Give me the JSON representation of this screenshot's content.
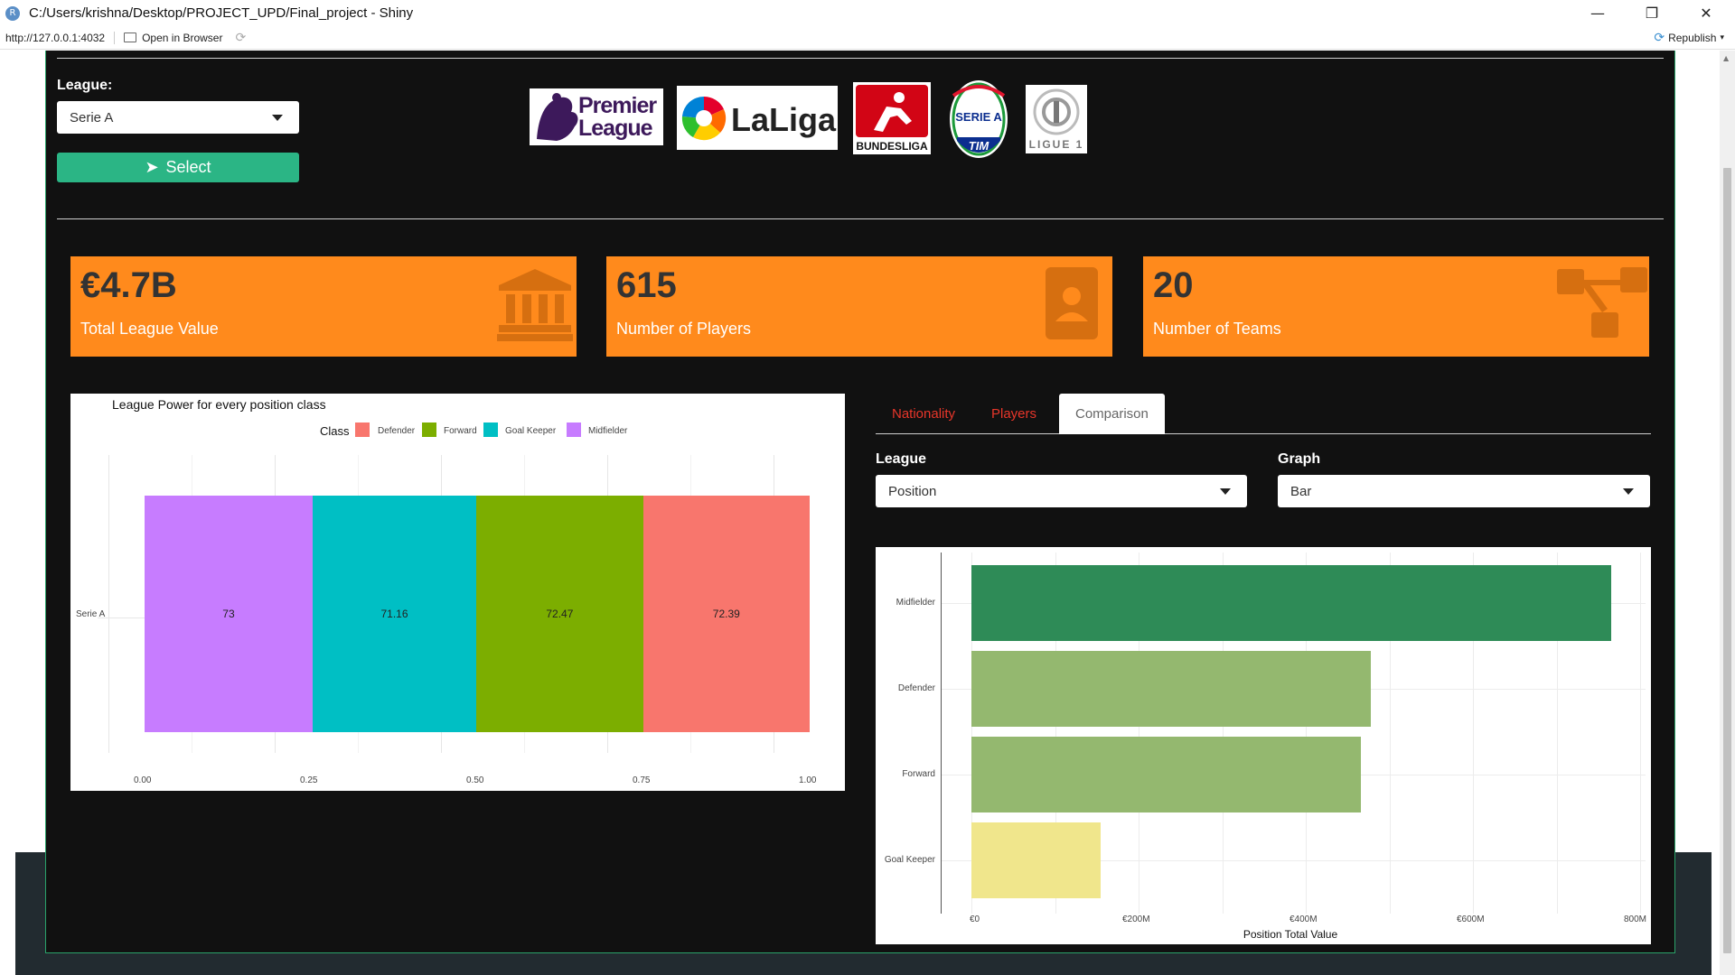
{
  "window": {
    "title": "C:/Users/krishna/Desktop/PROJECT_UPD/Final_project - Shiny",
    "url": "http://127.0.0.1:4032",
    "open_in_browser": "Open in Browser",
    "republish": "Republish",
    "minimize": "—",
    "restore": "❐",
    "close": "✕"
  },
  "sidebar": {
    "league_label": "League:",
    "league_selected": "Serie A",
    "select_button": "Select"
  },
  "logos": [
    "Premier League",
    "LaLiga",
    "BUNDESLIGA",
    "SERIE A TIM",
    "LIGUE 1"
  ],
  "logo_text": {
    "premier_1": "Premier",
    "premier_2": "League",
    "laliga": "LaLiga",
    "bundesliga": "BUNDESLIGA",
    "seriea_1": "SERIE A",
    "seriea_2": "TIM",
    "ligue1": "LIGUE 1"
  },
  "value_boxes": [
    {
      "value": "€4.7B",
      "label": "Total League Value",
      "icon": "institution-icon"
    },
    {
      "value": "615",
      "label": "Number of Players",
      "icon": "id-badge-icon"
    },
    {
      "value": "20",
      "label": "Number of Teams",
      "icon": "sitemap-icon"
    }
  ],
  "colors": {
    "accent": "#2bb585",
    "value_box": "#ff8a1c",
    "background": "#111111",
    "tab_link": "#e8362a"
  },
  "tabs": [
    {
      "label": "Nationality",
      "active": false
    },
    {
      "label": "Players",
      "active": false
    },
    {
      "label": "Comparison",
      "active": true
    }
  ],
  "controls": {
    "league_label": "League",
    "league_value": "Position",
    "graph_label": "Graph",
    "graph_value": "Bar"
  },
  "chart_data": [
    {
      "type": "bar",
      "orientation": "horizontal-stacked-fill",
      "title": "League Power for every position class",
      "legend_title": "Class",
      "legend_position": "top",
      "legend": [
        "Defender",
        "Forward",
        "Goal Keeper",
        "Midfielder"
      ],
      "legend_colors": [
        "#f8766d",
        "#7cae00",
        "#00bfc4",
        "#c77cff"
      ],
      "categories": [
        "Serie A"
      ],
      "series": [
        {
          "name": "Midfielder",
          "values": [
            73
          ],
          "label": "73",
          "color": "#c77cff"
        },
        {
          "name": "Goal Keeper",
          "values": [
            71.16
          ],
          "label": "71.16",
          "color": "#00bfc4"
        },
        {
          "name": "Forward",
          "values": [
            72.47
          ],
          "label": "72.47",
          "color": "#7cae00"
        },
        {
          "name": "Defender",
          "values": [
            72.39
          ],
          "label": "72.39",
          "color": "#f8766d"
        }
      ],
      "xticks": [
        "0.00",
        "0.25",
        "0.50",
        "0.75",
        "1.00"
      ],
      "xlim": [
        0,
        1
      ],
      "grid": true
    },
    {
      "type": "bar",
      "orientation": "horizontal",
      "xlabel": "Position Total Value",
      "categories": [
        "Midfielder",
        "Defender",
        "Forward",
        "Goal Keeper"
      ],
      "values": [
        765,
        478,
        466,
        155
      ],
      "value_units": "€M",
      "colors": [
        "#2e8b57",
        "#94b86f",
        "#94b86f",
        "#f0e68c"
      ],
      "xticks": [
        "€0",
        "€200M",
        "€400M",
        "€600M",
        "800M"
      ],
      "xlim": [
        0,
        800
      ],
      "grid": true
    }
  ]
}
